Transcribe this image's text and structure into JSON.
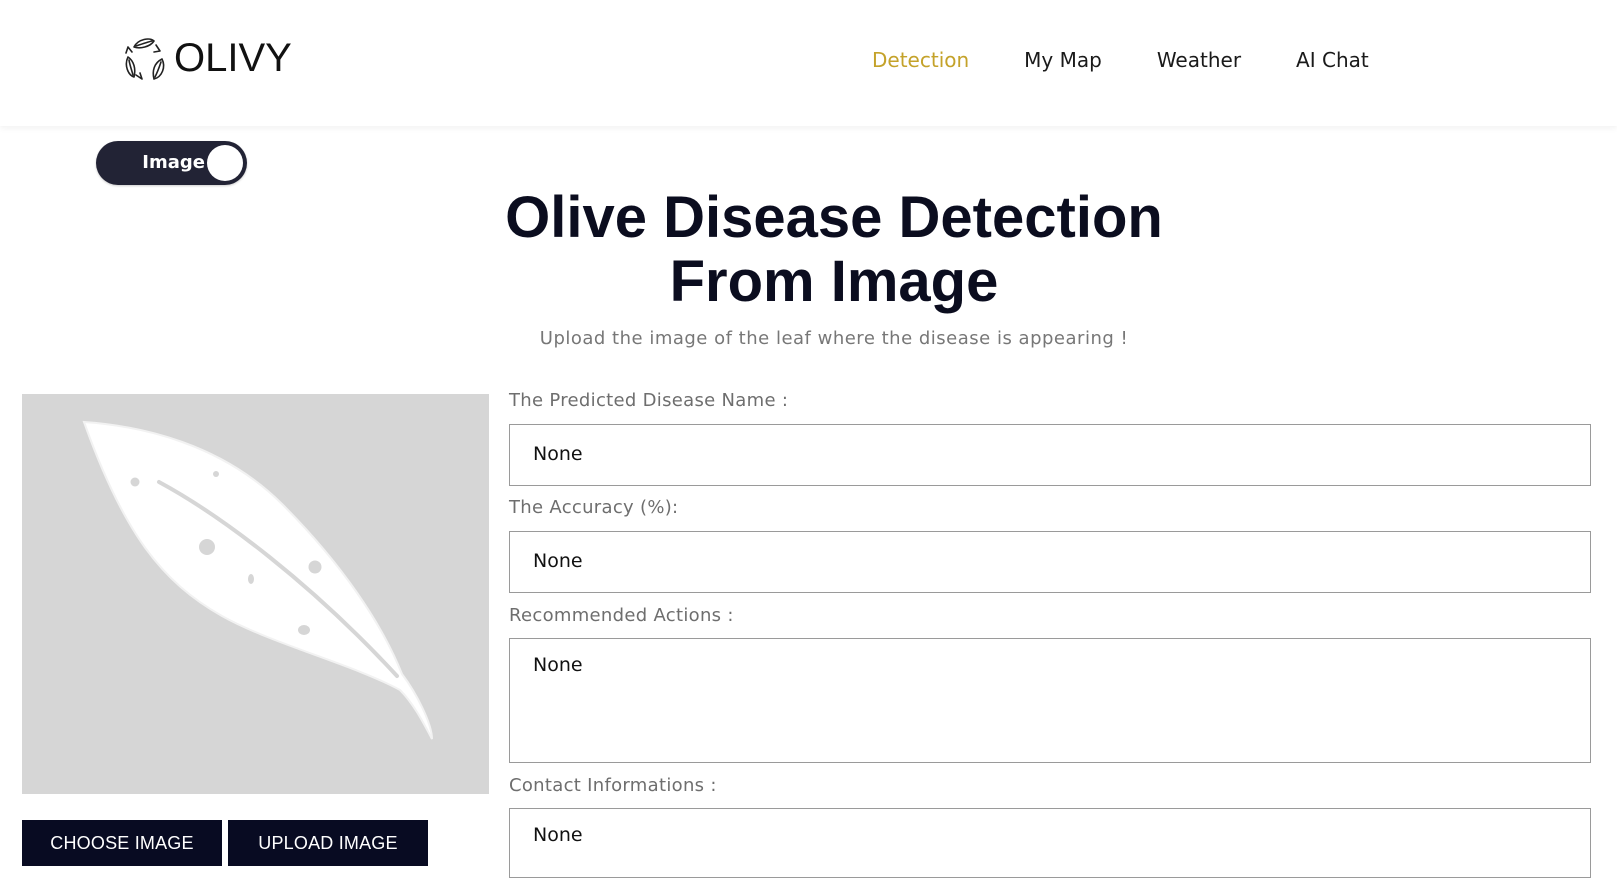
{
  "brand": {
    "name": "OLIVY",
    "icon": "recycle-leaves-icon"
  },
  "nav": {
    "items": [
      {
        "label": "Detection",
        "active": true
      },
      {
        "label": "My Map",
        "active": false
      },
      {
        "label": "Weather",
        "active": false
      },
      {
        "label": "AI Chat",
        "active": false
      }
    ],
    "active_color": "#c4a22a"
  },
  "mode_toggle": {
    "label": "Image",
    "state": "on",
    "color": "#222335"
  },
  "main": {
    "title_line1": "Olive Disease Detection",
    "title_line2": "From Image",
    "subtitle": "Upload the image of the leaf where the disease is appearing !"
  },
  "preview": {
    "icon": "leaf-placeholder-icon"
  },
  "buttons": {
    "choose_label": "CHOOSE IMAGE",
    "upload_label": "UPLOAD IMAGE",
    "color": "#080b22"
  },
  "results": {
    "disease_label": "The Predicted Disease Name :",
    "disease_value": "None",
    "accuracy_label": "The Accuracy (%):",
    "accuracy_value": "None",
    "actions_label": "Recommended Actions :",
    "actions_value": "None",
    "contact_label": "Contact Informations :",
    "contact_value": "None"
  }
}
